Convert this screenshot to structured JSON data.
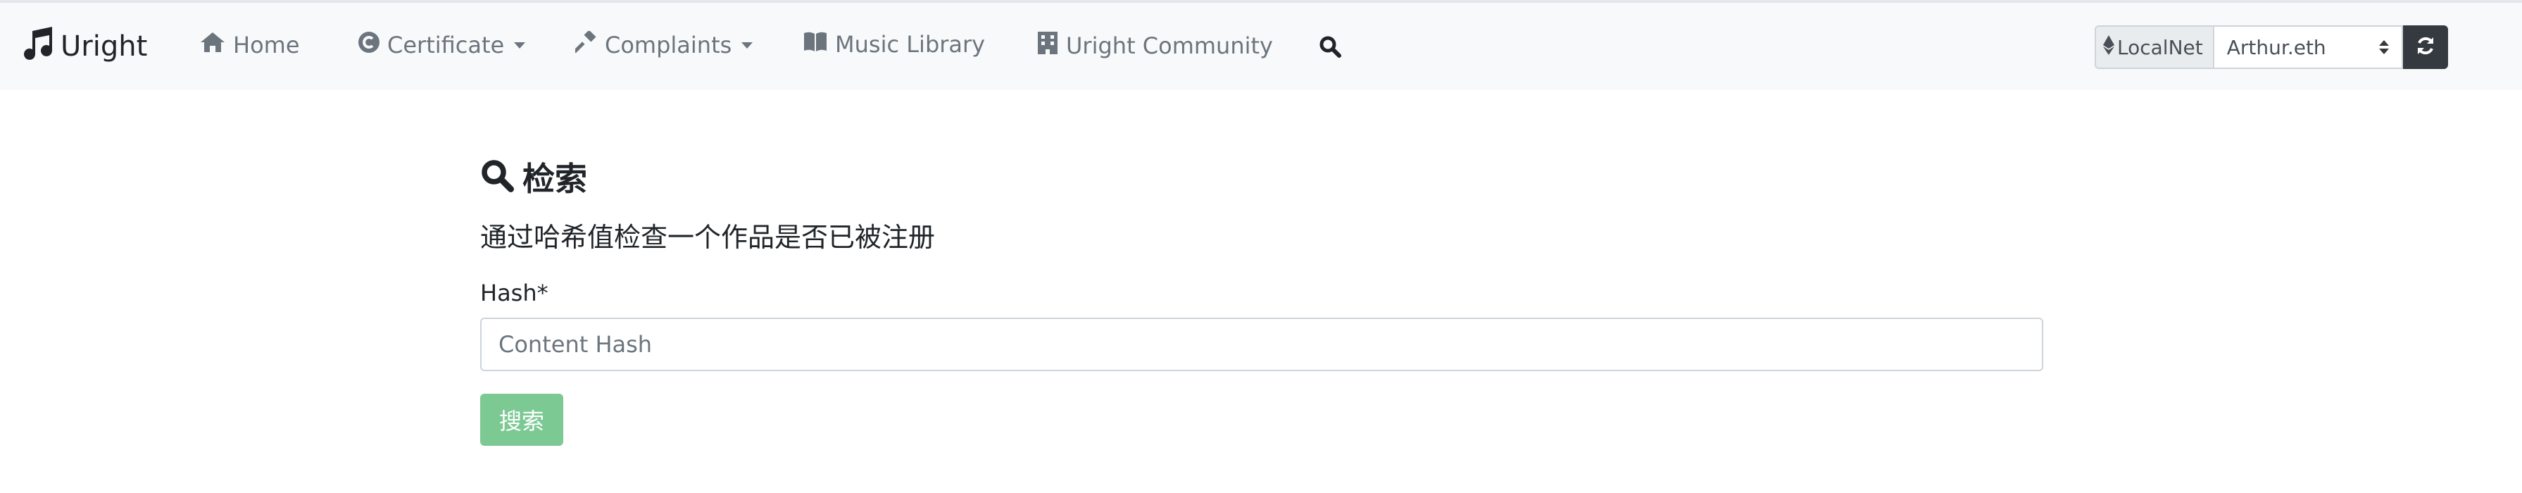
{
  "brand": {
    "name": "Uright",
    "icon": "music-note-icon"
  },
  "nav": {
    "home": {
      "label": "Home",
      "icon": "home-icon"
    },
    "certificate": {
      "label": "Certificate",
      "icon": "copyright-icon"
    },
    "complaints": {
      "label": "Complaints",
      "icon": "gavel-icon"
    },
    "music_library": {
      "label": "Music Library",
      "icon": "book-icon"
    },
    "community": {
      "label": "Uright Community",
      "icon": "building-icon"
    },
    "search_icon": "search-icon"
  },
  "network": {
    "prefix_label": "LocalNet",
    "prefix_icon": "ethereum-icon",
    "selected_account": "Arthur.eth",
    "refresh_icon": "refresh-icon"
  },
  "main": {
    "title": "检索",
    "subtitle": "通过哈希值检查一个作品是否已被注册",
    "hash_label": "Hash*",
    "hash_placeholder": "Content Hash",
    "hash_value": "",
    "submit_label": "搜索"
  },
  "colors": {
    "navbar_bg": "#f8f9fa",
    "nav_link": "#6c757d",
    "submit_bg": "#7dc994",
    "refresh_bg": "#343a40"
  }
}
